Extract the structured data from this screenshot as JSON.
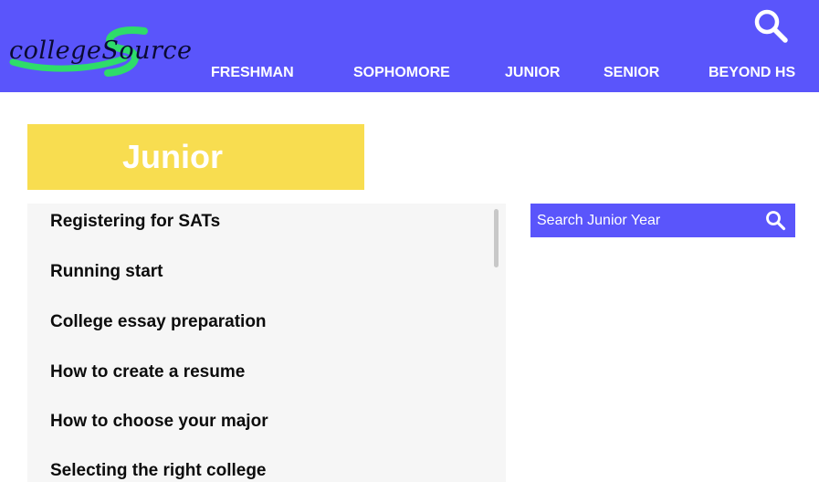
{
  "header": {
    "logo_text": "collegeSource",
    "nav": [
      {
        "label": "FRESHMAN"
      },
      {
        "label": "SOPHOMORE"
      },
      {
        "label": "JUNIOR"
      },
      {
        "label": "SENIOR"
      },
      {
        "label": "BEYOND HS"
      }
    ],
    "search_icon": "search-icon"
  },
  "page": {
    "title": "Junior"
  },
  "topics": [
    "Registering for SATs",
    "Running start",
    "College essay preparation",
    "How to create a resume",
    "How to choose your major",
    "Selecting the right college"
  ],
  "search": {
    "placeholder": "Search Junior Year",
    "icon": "search-icon"
  },
  "colors": {
    "header_bg": "#5a55fb",
    "title_bg": "#f8dd50",
    "logo_swoosh": "#2edc6a",
    "list_bg": "#f6f6f6"
  }
}
